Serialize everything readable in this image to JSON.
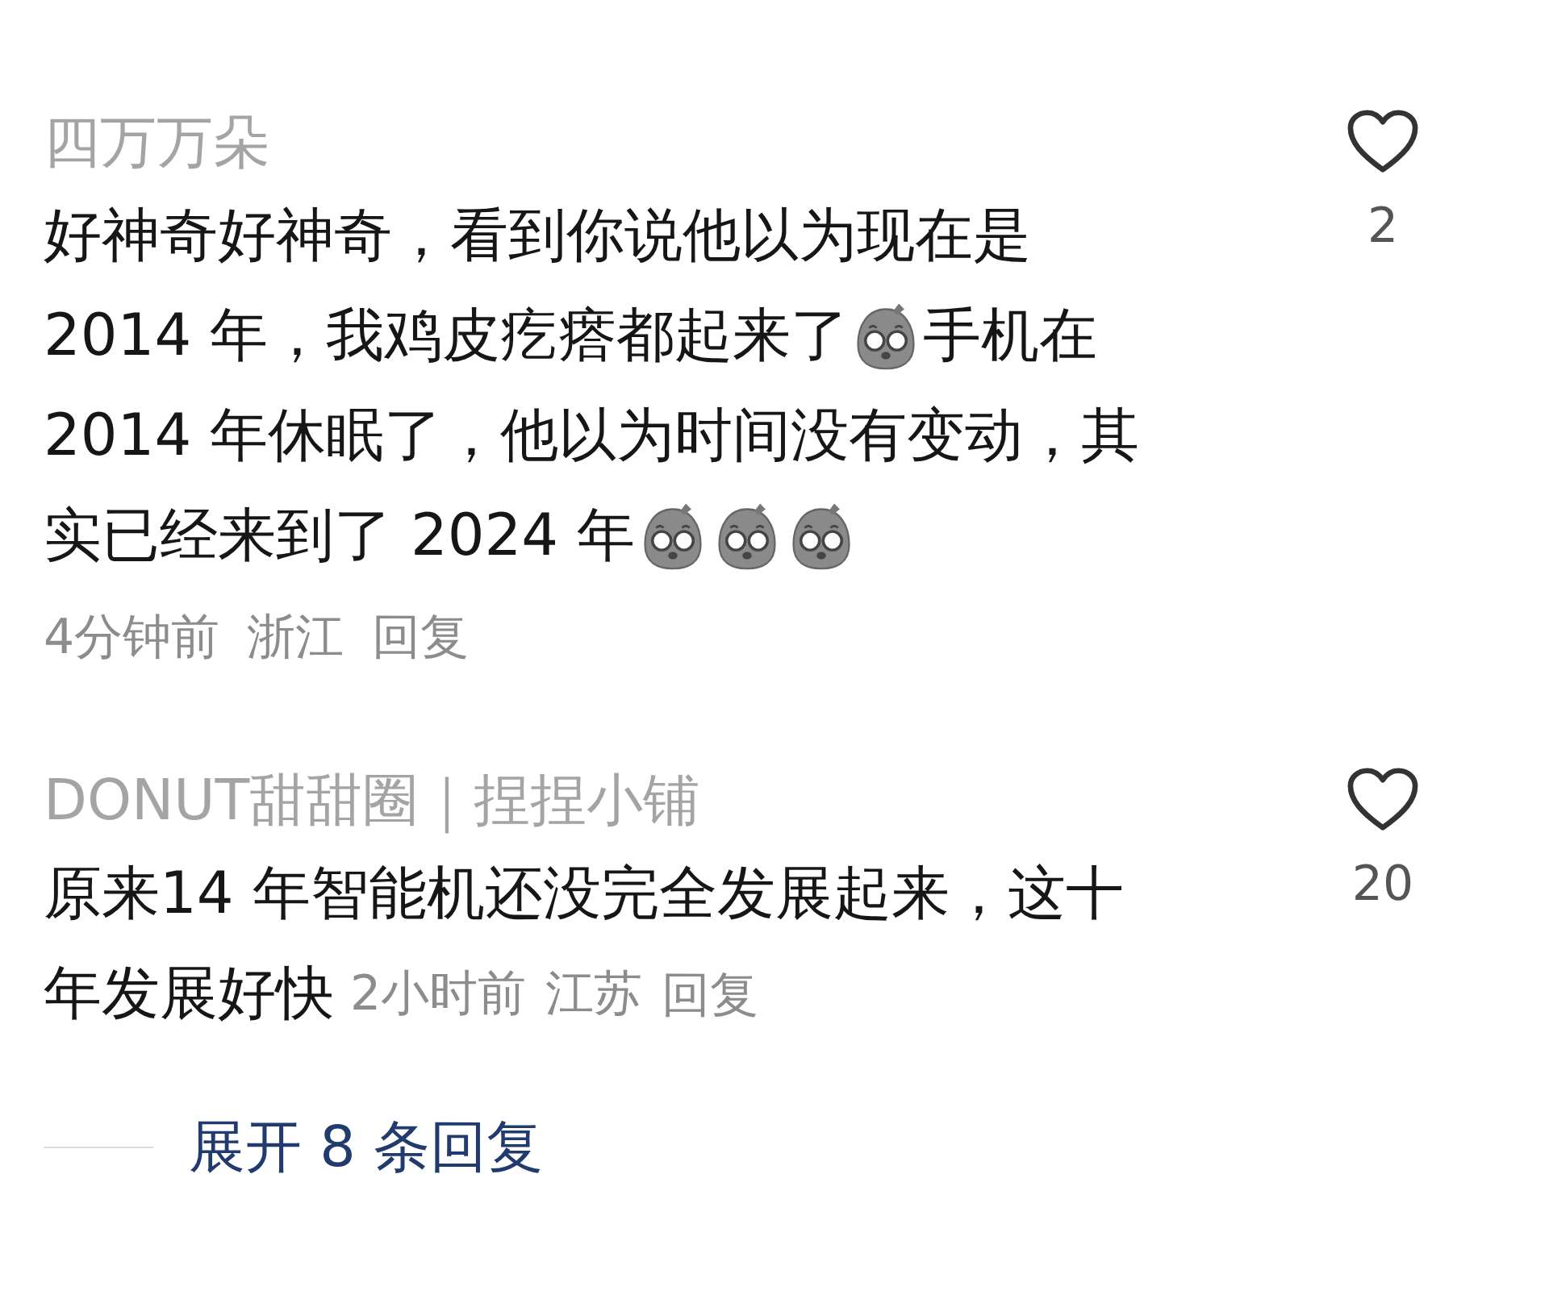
{
  "comments": [
    {
      "username": "四万万朵",
      "lines": [
        [
          {
            "kind": "text",
            "text": "好神奇好神奇，看到你说他以为现在是"
          }
        ],
        [
          {
            "kind": "text",
            "text": "2014 年，我鸡皮疙瘩都起来了"
          },
          {
            "kind": "sticker"
          },
          {
            "kind": "text",
            "text": "手机在"
          }
        ],
        [
          {
            "kind": "text",
            "text": "2014 年休眠了，他以为时间没有变动，其"
          }
        ],
        [
          {
            "kind": "text",
            "text": "实已经来到了 2024 年"
          },
          {
            "kind": "sticker"
          },
          {
            "kind": "sticker"
          },
          {
            "kind": "sticker"
          }
        ]
      ],
      "meta_inline": false,
      "time": "4分钟前",
      "location": "浙江",
      "reply": "回复",
      "likes": "2",
      "liked": false
    },
    {
      "username": "DONUT甜甜圈｜捏捏小铺",
      "lines": [
        [
          {
            "kind": "text",
            "text": "原来14 年智能机还没完全发展起来，这十"
          }
        ],
        [
          {
            "kind": "text",
            "text": "年发展好快"
          }
        ]
      ],
      "meta_inline": true,
      "time": "2小时前",
      "location": "江苏",
      "reply": "回复",
      "likes": "20",
      "liked": false
    }
  ],
  "expand_replies": "展开 8 条回复"
}
